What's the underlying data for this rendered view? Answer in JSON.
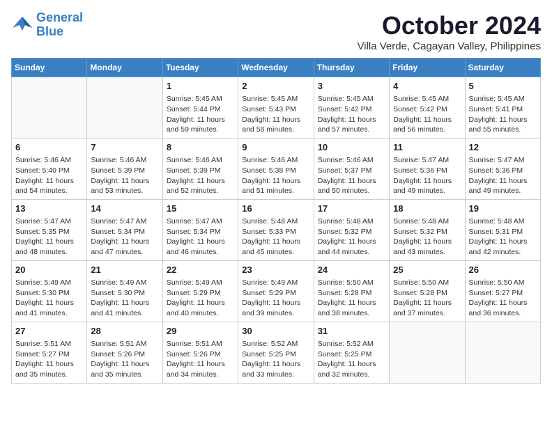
{
  "logo": {
    "line1": "General",
    "line2": "Blue"
  },
  "title": "October 2024",
  "subtitle": "Villa Verde, Cagayan Valley, Philippines",
  "weekdays": [
    "Sunday",
    "Monday",
    "Tuesday",
    "Wednesday",
    "Thursday",
    "Friday",
    "Saturday"
  ],
  "weeks": [
    [
      {
        "day": "",
        "info": ""
      },
      {
        "day": "",
        "info": ""
      },
      {
        "day": "1",
        "info": "Sunrise: 5:45 AM\nSunset: 5:44 PM\nDaylight: 11 hours and 59 minutes."
      },
      {
        "day": "2",
        "info": "Sunrise: 5:45 AM\nSunset: 5:43 PM\nDaylight: 11 hours and 58 minutes."
      },
      {
        "day": "3",
        "info": "Sunrise: 5:45 AM\nSunset: 5:42 PM\nDaylight: 11 hours and 57 minutes."
      },
      {
        "day": "4",
        "info": "Sunrise: 5:45 AM\nSunset: 5:42 PM\nDaylight: 11 hours and 56 minutes."
      },
      {
        "day": "5",
        "info": "Sunrise: 5:45 AM\nSunset: 5:41 PM\nDaylight: 11 hours and 55 minutes."
      }
    ],
    [
      {
        "day": "6",
        "info": "Sunrise: 5:46 AM\nSunset: 5:40 PM\nDaylight: 11 hours and 54 minutes."
      },
      {
        "day": "7",
        "info": "Sunrise: 5:46 AM\nSunset: 5:39 PM\nDaylight: 11 hours and 53 minutes."
      },
      {
        "day": "8",
        "info": "Sunrise: 5:46 AM\nSunset: 5:39 PM\nDaylight: 11 hours and 52 minutes."
      },
      {
        "day": "9",
        "info": "Sunrise: 5:46 AM\nSunset: 5:38 PM\nDaylight: 11 hours and 51 minutes."
      },
      {
        "day": "10",
        "info": "Sunrise: 5:46 AM\nSunset: 5:37 PM\nDaylight: 11 hours and 50 minutes."
      },
      {
        "day": "11",
        "info": "Sunrise: 5:47 AM\nSunset: 5:36 PM\nDaylight: 11 hours and 49 minutes."
      },
      {
        "day": "12",
        "info": "Sunrise: 5:47 AM\nSunset: 5:36 PM\nDaylight: 11 hours and 49 minutes."
      }
    ],
    [
      {
        "day": "13",
        "info": "Sunrise: 5:47 AM\nSunset: 5:35 PM\nDaylight: 11 hours and 48 minutes."
      },
      {
        "day": "14",
        "info": "Sunrise: 5:47 AM\nSunset: 5:34 PM\nDaylight: 11 hours and 47 minutes."
      },
      {
        "day": "15",
        "info": "Sunrise: 5:47 AM\nSunset: 5:34 PM\nDaylight: 11 hours and 46 minutes."
      },
      {
        "day": "16",
        "info": "Sunrise: 5:48 AM\nSunset: 5:33 PM\nDaylight: 11 hours and 45 minutes."
      },
      {
        "day": "17",
        "info": "Sunrise: 5:48 AM\nSunset: 5:32 PM\nDaylight: 11 hours and 44 minutes."
      },
      {
        "day": "18",
        "info": "Sunrise: 5:48 AM\nSunset: 5:32 PM\nDaylight: 11 hours and 43 minutes."
      },
      {
        "day": "19",
        "info": "Sunrise: 5:48 AM\nSunset: 5:31 PM\nDaylight: 11 hours and 42 minutes."
      }
    ],
    [
      {
        "day": "20",
        "info": "Sunrise: 5:49 AM\nSunset: 5:30 PM\nDaylight: 11 hours and 41 minutes."
      },
      {
        "day": "21",
        "info": "Sunrise: 5:49 AM\nSunset: 5:30 PM\nDaylight: 11 hours and 41 minutes."
      },
      {
        "day": "22",
        "info": "Sunrise: 5:49 AM\nSunset: 5:29 PM\nDaylight: 11 hours and 40 minutes."
      },
      {
        "day": "23",
        "info": "Sunrise: 5:49 AM\nSunset: 5:29 PM\nDaylight: 11 hours and 39 minutes."
      },
      {
        "day": "24",
        "info": "Sunrise: 5:50 AM\nSunset: 5:28 PM\nDaylight: 11 hours and 38 minutes."
      },
      {
        "day": "25",
        "info": "Sunrise: 5:50 AM\nSunset: 5:28 PM\nDaylight: 11 hours and 37 minutes."
      },
      {
        "day": "26",
        "info": "Sunrise: 5:50 AM\nSunset: 5:27 PM\nDaylight: 11 hours and 36 minutes."
      }
    ],
    [
      {
        "day": "27",
        "info": "Sunrise: 5:51 AM\nSunset: 5:27 PM\nDaylight: 11 hours and 35 minutes."
      },
      {
        "day": "28",
        "info": "Sunrise: 5:51 AM\nSunset: 5:26 PM\nDaylight: 11 hours and 35 minutes."
      },
      {
        "day": "29",
        "info": "Sunrise: 5:51 AM\nSunset: 5:26 PM\nDaylight: 11 hours and 34 minutes."
      },
      {
        "day": "30",
        "info": "Sunrise: 5:52 AM\nSunset: 5:25 PM\nDaylight: 11 hours and 33 minutes."
      },
      {
        "day": "31",
        "info": "Sunrise: 5:52 AM\nSunset: 5:25 PM\nDaylight: 11 hours and 32 minutes."
      },
      {
        "day": "",
        "info": ""
      },
      {
        "day": "",
        "info": ""
      }
    ]
  ]
}
